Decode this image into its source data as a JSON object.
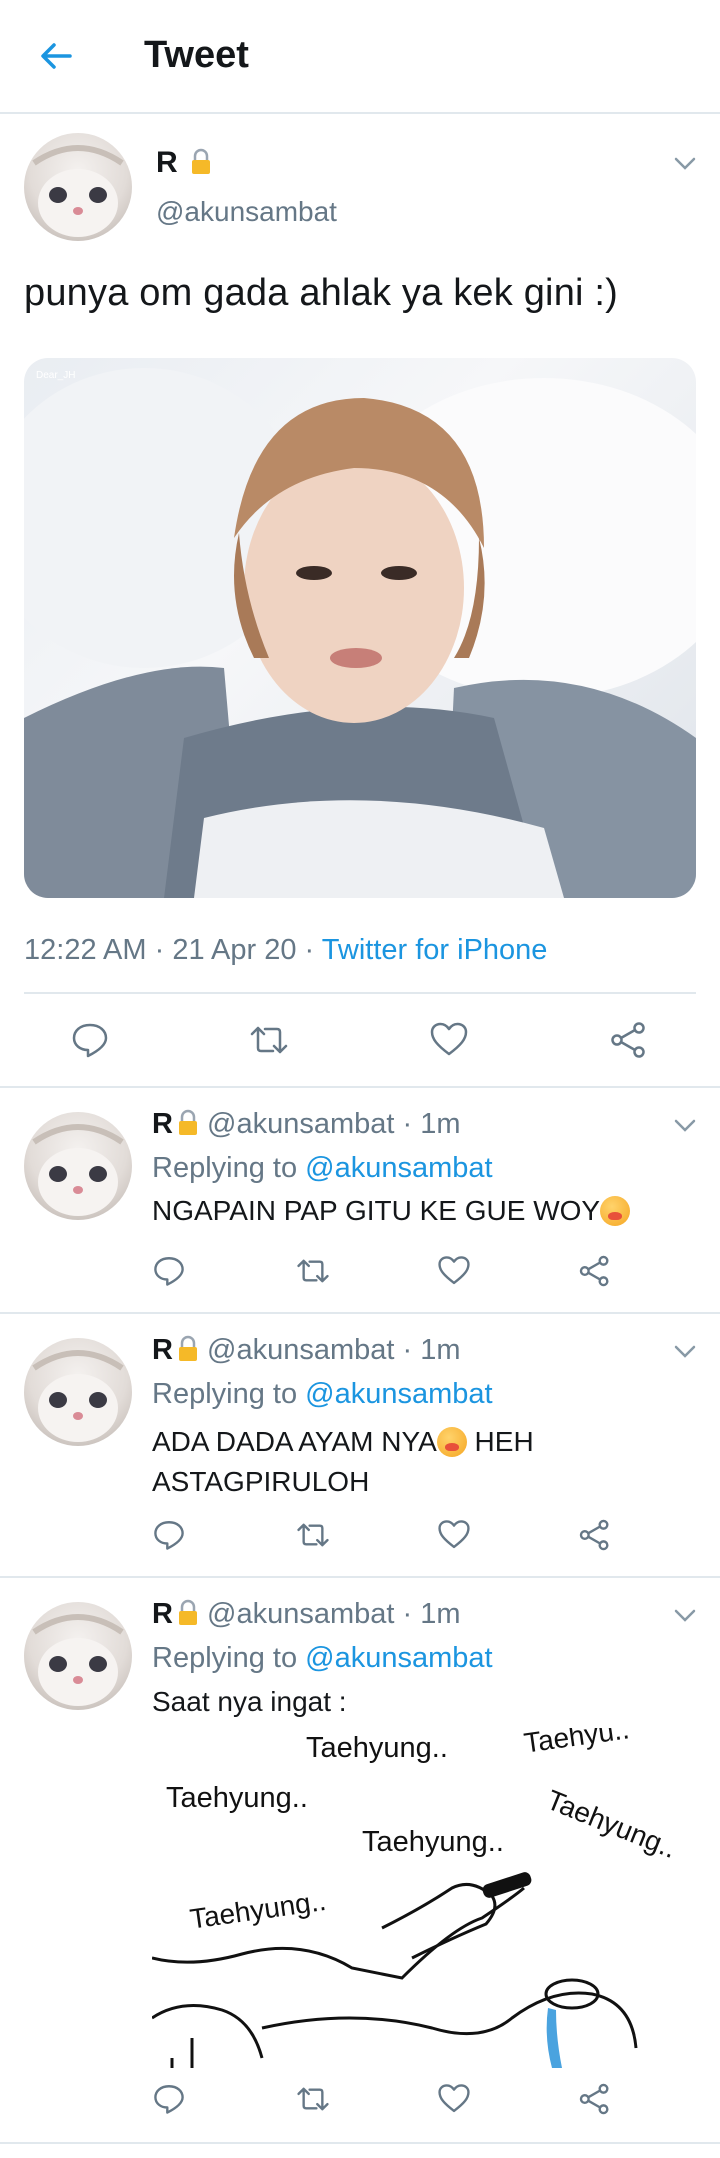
{
  "header": {
    "title": "Tweet"
  },
  "main_tweet": {
    "name": "R",
    "handle": "@akunsambat",
    "text": "punya om gada ahlak ya kek gini :)",
    "image_watermark": "Dear_JH",
    "time": "12:22 AM",
    "sep1": "·",
    "date": "21 Apr 20",
    "sep2": "·",
    "source": "Twitter for iPhone"
  },
  "replies": [
    {
      "name": "R",
      "handle": "@akunsambat",
      "sep": "·",
      "time": "1m",
      "replying_label": "Replying to",
      "replying_to": "@akunsambat",
      "text": "NGAPAIN PAP GITU KE GUE WOY"
    },
    {
      "name": "R",
      "handle": "@akunsambat",
      "sep": "·",
      "time": "1m",
      "replying_label": "Replying to",
      "replying_to": "@akunsambat",
      "text_line1": "ADA DADA AYAM NYA",
      "text_line1_end": "HEH",
      "text_line2": "ASTAGPIRULOH"
    },
    {
      "name": "R",
      "handle": "@akunsambat",
      "sep": "·",
      "time": "1m",
      "replying_label": "Replying to",
      "replying_to": "@akunsambat",
      "text": "Saat nya ingat :",
      "meme_words": [
        "Taehyung..",
        "Taehyu..",
        "Taehyung..",
        "Taehyung..",
        "Taehyung..",
        "Taehyung.."
      ]
    }
  ],
  "icons": [
    "back-arrow-icon",
    "chevron-down-icon",
    "lock-icon",
    "reply-icon",
    "retweet-icon",
    "like-icon",
    "share-icon",
    "tired-face-emoji-icon"
  ],
  "colors": {
    "accent": "#1b95e0",
    "muted": "#657786",
    "border": "#e1e8ed"
  }
}
